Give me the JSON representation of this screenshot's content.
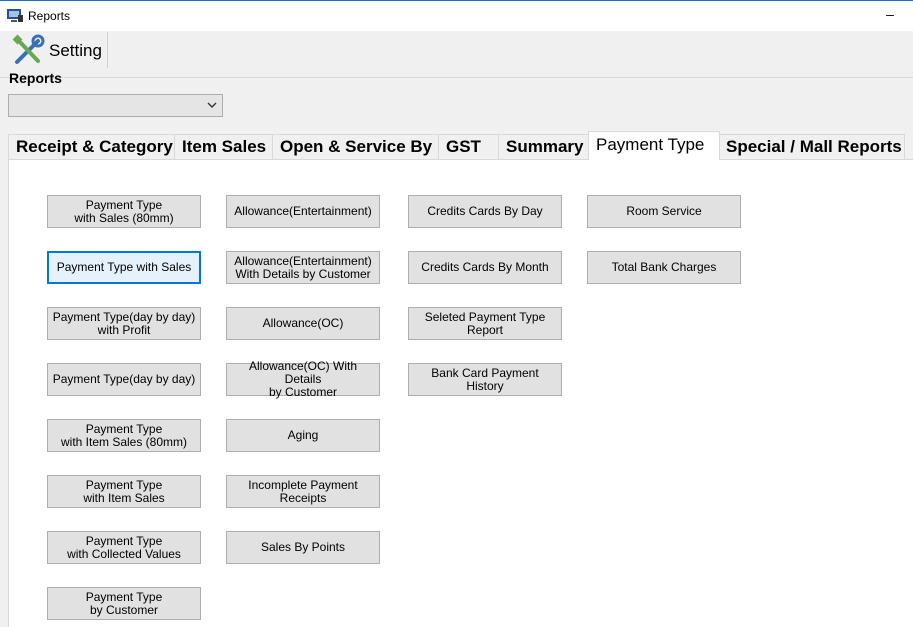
{
  "window": {
    "title": "Reports"
  },
  "toolbar": {
    "setting_label": "Setting"
  },
  "reports": {
    "label": "Reports",
    "selected": ""
  },
  "tabs": [
    {
      "label": "Receipt & Category"
    },
    {
      "label": "Item Sales"
    },
    {
      "label": "Open & Service By"
    },
    {
      "label": "GST"
    },
    {
      "label": "Summary"
    },
    {
      "label": "Payment Type"
    },
    {
      "label": "Special / Mall Reports"
    }
  ],
  "active_tab": "Payment Type",
  "buttons": {
    "col1": [
      "Payment Type\nwith Sales (80mm)",
      "Payment Type with Sales",
      "Payment Type(day by day)\nwith Profit",
      "Payment Type(day by day)",
      "Payment Type\nwith Item Sales (80mm)",
      "Payment Type\nwith Item Sales",
      "Payment Type\nwith Collected Values",
      "Payment Type\nby Customer"
    ],
    "col2": [
      "Allowance(Entertainment)",
      "Allowance(Entertainment)\nWith Details by Customer",
      "Allowance(OC)",
      "Allowance(OC) With Details\nby Customer",
      "Aging",
      "Incomplete Payment Receipts",
      "Sales By Points"
    ],
    "col3": [
      "Credits Cards By Day",
      "Credits Cards By Month",
      "Seleted Payment Type\nReport",
      "Bank Card Payment History"
    ],
    "col4": [
      "Room Service",
      "Total Bank Charges"
    ]
  },
  "colors": {
    "focus_border": "#0078d7",
    "button_face": "#e1e1e1",
    "title_accent": "#1e6fc8"
  }
}
